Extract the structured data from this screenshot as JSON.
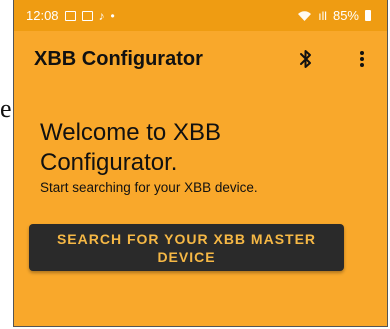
{
  "status_bar": {
    "time": "12:08",
    "signal_text": "ıll",
    "battery_percent": "85%",
    "icons": [
      "image-icon",
      "calendar-icon",
      "tiktok-icon",
      "dot-icon",
      "wifi-icon",
      "signal-icon",
      "battery-icon"
    ]
  },
  "app_bar": {
    "title": "XBB Configurator",
    "bluetooth_icon": "bluetooth-icon",
    "menu_icon": "more-vert-icon"
  },
  "main": {
    "welcome": "Welcome to XBB Configurator.",
    "subtitle": "Start searching for your XBB device.",
    "search_button_label": "SEARCH FOR YOUR XBB MASTER DEVICE"
  },
  "colors": {
    "background": "#F9A82B",
    "status_bar": "#EF9C12",
    "button": "#2A2A2A",
    "button_text": "#F6B845"
  }
}
